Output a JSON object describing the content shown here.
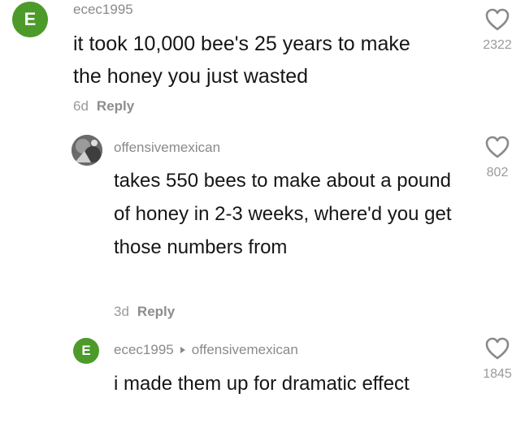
{
  "colors": {
    "avatar_green": "#4c9a2a",
    "username_gray": "#8a8a8a",
    "meta_gray": "#9a9a9a"
  },
  "comments": [
    {
      "avatar_letter": "E",
      "username": "ecec1995",
      "text": "it took 10,000 bee's 25 years to make the honey you just wasted",
      "age": "6d",
      "reply_label": "Reply",
      "likes": "2322",
      "like_icon": "heart-outline-icon"
    },
    {
      "avatar_icon": "profile-photo",
      "username": "offensivemexican",
      "text": "takes 550 bees to make about a pound of honey in 2-3 weeks, where'd you get those numbers from",
      "age": "3d",
      "reply_label": "Reply",
      "likes": "802",
      "like_icon": "heart-outline-icon"
    },
    {
      "avatar_letter": "E",
      "username": "ecec1995",
      "reply_to": "offensivemexican",
      "text": "i made them up for dramatic effect",
      "likes": "1845",
      "like_icon": "heart-outline-icon"
    }
  ]
}
